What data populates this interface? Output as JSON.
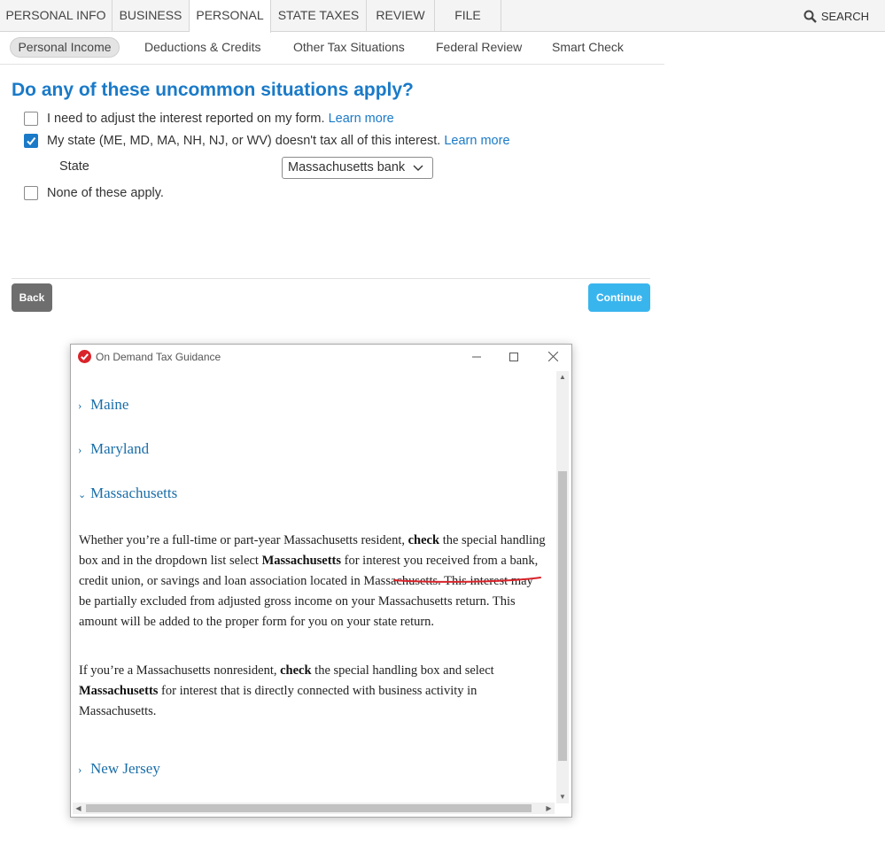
{
  "topnav": {
    "tabs": [
      {
        "label": "PERSONAL INFO"
      },
      {
        "label": "BUSINESS"
      },
      {
        "label": "PERSONAL"
      },
      {
        "label": "STATE TAXES"
      },
      {
        "label": "REVIEW"
      },
      {
        "label": "FILE"
      }
    ],
    "active_tab": "PERSONAL",
    "search_label": "SEARCH"
  },
  "subnav": {
    "items": [
      {
        "label": "Personal Income"
      },
      {
        "label": "Deductions & Credits"
      },
      {
        "label": "Other Tax Situations"
      },
      {
        "label": "Federal Review"
      },
      {
        "label": "Smart Check"
      }
    ],
    "active_item": "Personal Income"
  },
  "main": {
    "question": "Do any of these uncommon situations apply?",
    "options": [
      {
        "text": "I need to adjust the interest reported on my form.",
        "link": "Learn more",
        "checked": false
      },
      {
        "text": "My state (ME, MD, MA, NH, NJ, or WV) doesn't tax all of this interest.",
        "link": "Learn more",
        "checked": true
      },
      {
        "text": "None of these apply.",
        "checked": false
      }
    ],
    "state_label": "State",
    "state_value": "Massachusetts bank",
    "back_label": "Back",
    "continue_label": "Continue"
  },
  "guidance": {
    "window_title": "On Demand Tax Guidance",
    "sections": [
      "Maine",
      "Maryland",
      "Massachusetts",
      "New Jersey"
    ],
    "para1": {
      "t1": "Whether you’re a full-time or part-year Massachusetts resident, ",
      "b1": "check",
      "t2": " the special handling box and in the dropdown list select ",
      "b2": "Massachusetts",
      "t3": " for interest you received from a bank, credit union, or savings and loan association ",
      "t4": "located in Massachusetts",
      "t5": ". This interest may be partially excluded from adjusted gross income on your Massachusetts return. This amount will be added to the proper form for you on your state return."
    },
    "para2": {
      "t1": "If you’re a Massachusetts nonresident, ",
      "b1": "check",
      "t2": " the special handling box and select ",
      "b2": "Massachusetts",
      "t3": " for interest that is directly connected with business activity in Massachusetts."
    },
    "annotation_color": "#d9232a"
  },
  "colors": {
    "accent": "#1a7ac8",
    "continue_button": "#39b5ee",
    "back_button": "#6e6e6e"
  }
}
